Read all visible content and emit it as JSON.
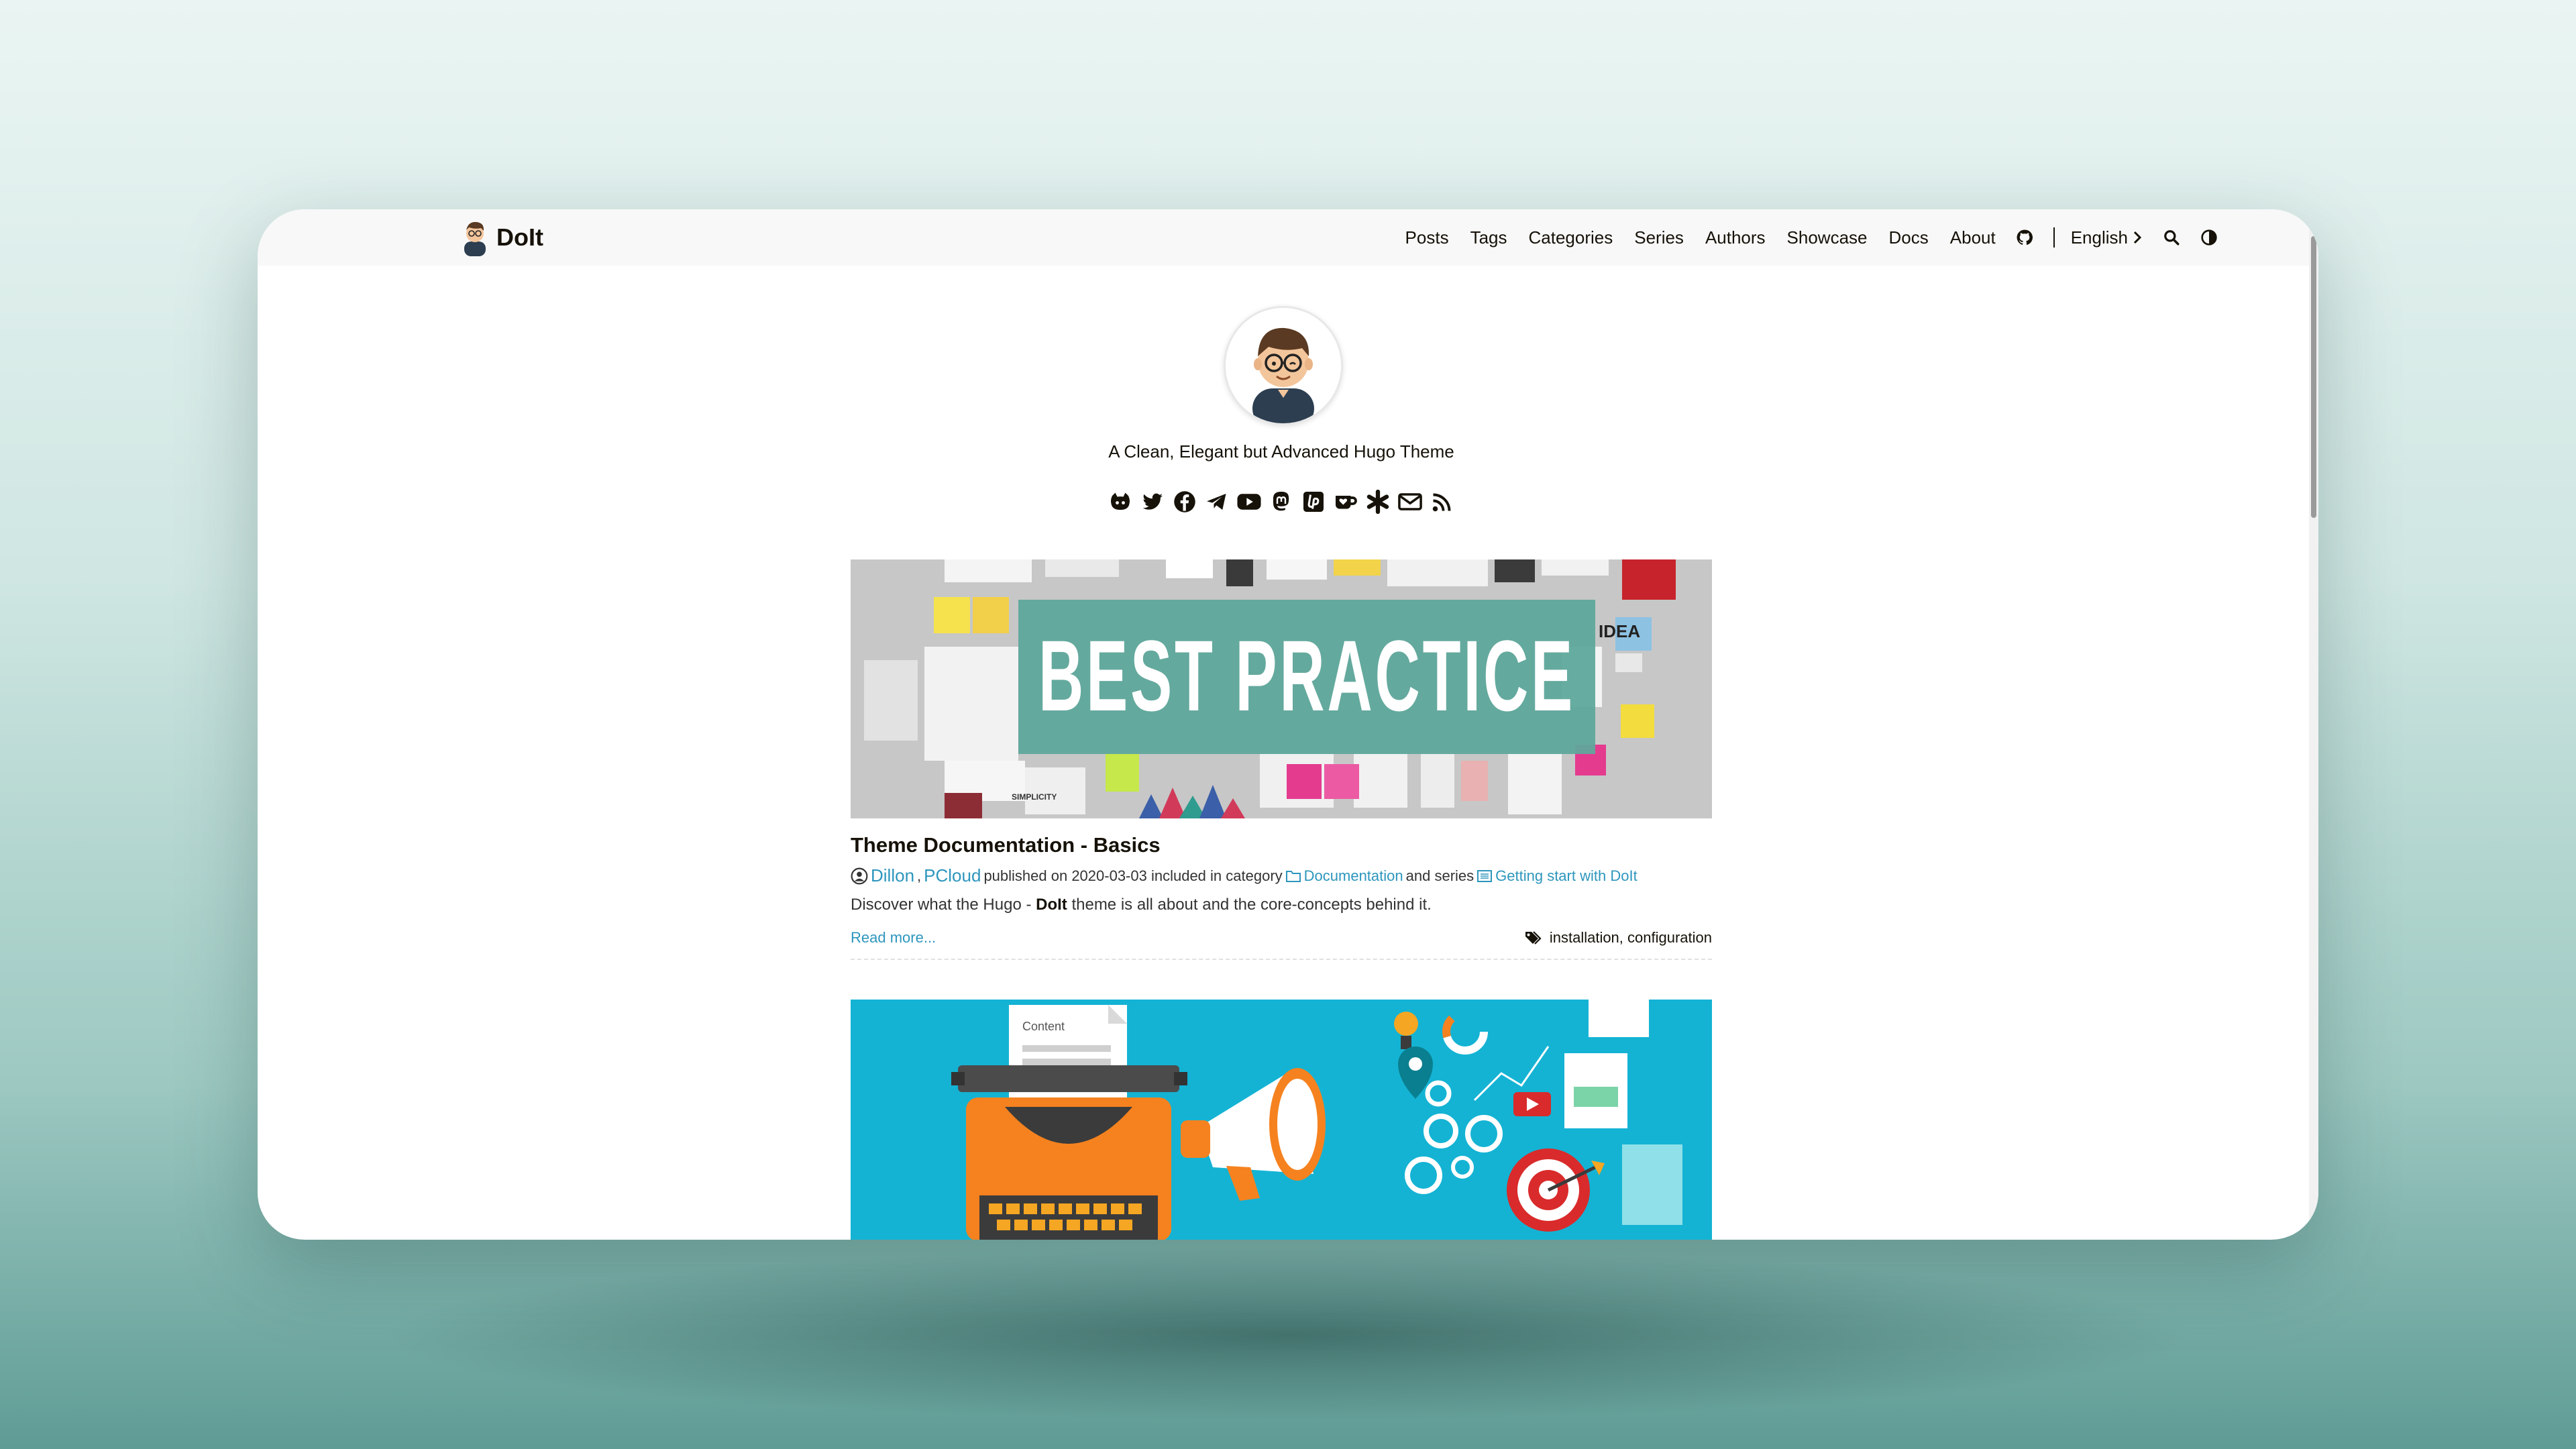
{
  "header": {
    "brand": "DoIt",
    "nav": [
      "Posts",
      "Tags",
      "Categories",
      "Series",
      "Authors",
      "Showcase",
      "Docs",
      "About"
    ],
    "language": "English"
  },
  "profile": {
    "subtitle": "A Clean, Elegant but Advanced Hugo Theme",
    "social_icons": [
      "github-icon",
      "twitter-icon",
      "facebook-icon",
      "telegram-icon",
      "youtube-icon",
      "mastodon-icon",
      "liberapay-icon",
      "kofi-icon",
      "asterisk-icon",
      "email-icon",
      "rss-icon"
    ]
  },
  "posts": [
    {
      "image_text": "BEST PRACTICE",
      "image_small_labels": [
        "SIMPLICITY",
        "IDEA"
      ],
      "title": "Theme Documentation - Basics",
      "author1": "Dillon",
      "author_sep": ",",
      "author2": "PCloud",
      "published_label": "published on 2020-03-03 included in category",
      "category": "Documentation",
      "series_label": "and series",
      "series": "Getting start with DoIt",
      "summary_pre": "Discover what the Hugo -",
      "summary_bold": "DoIt",
      "summary_post": "theme is all about and the core-concepts behind it.",
      "read_more": "Read more...",
      "tags": "installation, configuration"
    },
    {
      "image_label": "Content"
    }
  ],
  "colors": {
    "accent": "#2d96bd",
    "teal_banner": "#5fa89c",
    "cyan_image": "#14b3d4"
  }
}
